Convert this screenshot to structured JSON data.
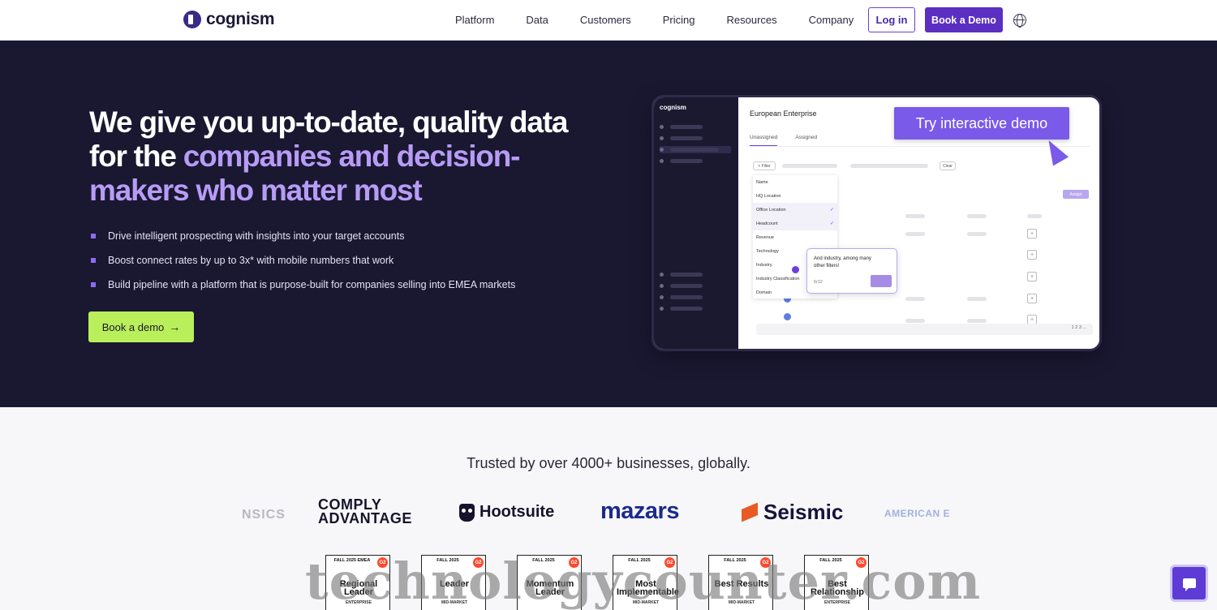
{
  "nav": {
    "logo_text": "cognism",
    "links": [
      "Platform",
      "Data",
      "Customers",
      "Pricing",
      "Resources",
      "Company"
    ],
    "login_label": "Log in",
    "book_demo_label": "Book a Demo"
  },
  "hero": {
    "title_part1": "We give you up-to-date, quality data for the ",
    "title_highlight": "companies and decision-makers who matter most",
    "bullets": [
      "Drive intelligent prospecting with insights into your target accounts",
      "Boost connect rates by up to 3x* with mobile numbers that work",
      "Build pipeline with a platform that is purpose-built for companies selling into EMEA markets"
    ],
    "cta_label": "Book a demo",
    "cta_arrow": "→"
  },
  "demo": {
    "mini_logo": "cognism",
    "header": "European Enterprise",
    "tabs": [
      "Unassigned",
      "Assigned"
    ],
    "filter_label": "+ Filter",
    "clear_label": "Clear",
    "assign_label": "Assign",
    "dropdown_items": [
      "Name",
      "HQ Location",
      "Office Location",
      "Headcount",
      "Revenue",
      "Technology",
      "Industry",
      "Industry Classification",
      "Domain"
    ],
    "tooltip_text": "And industry, among many other filters!",
    "tooltip_count": "6/12",
    "cta": "Try interactive demo",
    "pager": "1  2  3  ..."
  },
  "trust": {
    "heading": "Trusted by over 4000+ businesses, globally."
  },
  "brands": {
    "forensics": "NSICS",
    "comply_line1": "COMPLY",
    "comply_line2": "ADVANTAGE",
    "hootsuite": "Hootsuite",
    "mazars": "mazars",
    "seismic": "Seismic",
    "american": "AMERICAN E"
  },
  "badges": [
    {
      "top": "FALL 2025 EMEA",
      "title": "Regional Leader",
      "segment": "ENTERPRISE"
    },
    {
      "top": "FALL 2025",
      "title": "Leader",
      "segment": "MID-MARKET"
    },
    {
      "top": "FALL 2025",
      "title": "Momentum Leader",
      "segment": ""
    },
    {
      "top": "FALL 2025",
      "title": "Most Implementable",
      "segment": "MID-MARKET"
    },
    {
      "top": "FALL 2025",
      "title": "Best Results",
      "segment": "MID-MARKET"
    },
    {
      "top": "FALL 2025",
      "title": "Best Relationship",
      "segment": "ENTERPRISE"
    }
  ],
  "g2_label": "G2",
  "watermark": "technologycounter.com",
  "colors": {
    "hero_bg": "#1a1731",
    "accent_purple": "#5a2fc2",
    "highlight": "#b79cf6",
    "cta_green": "#b9ef5a"
  }
}
